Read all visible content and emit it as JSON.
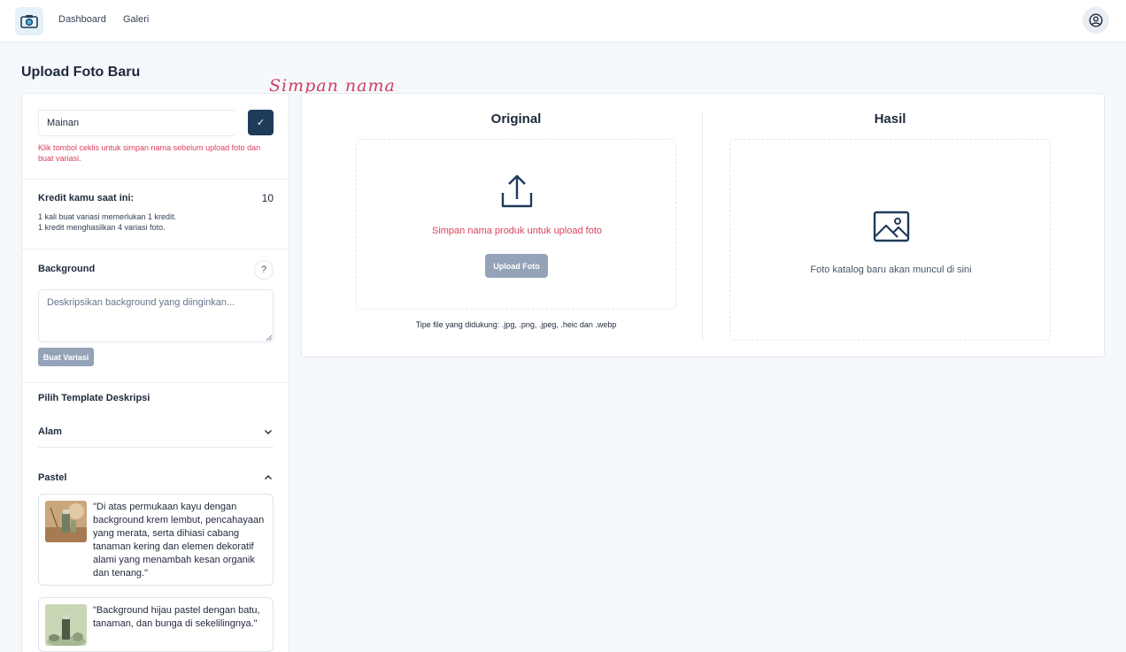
{
  "nav": {
    "items": [
      {
        "label": "Dashboard"
      },
      {
        "label": "Galeri"
      }
    ]
  },
  "page": {
    "title": "Upload Foto Baru",
    "annotation": "Simpan nama"
  },
  "name_section": {
    "value": "Mainan",
    "check_icon": "✓",
    "hint": "Klik tombol ceklis untuk simpan nama sebelum upload foto dan buat variasi."
  },
  "credit": {
    "label": "Kredit kamu saat ini:",
    "value": "10",
    "note_line1": "1 kali buat variasi memerlukan 1 kredit.",
    "note_line2": "1 kredit menghasilkan 4 variasi foto."
  },
  "background": {
    "label": "Background",
    "help": "?",
    "placeholder": "Deskripsikan background yang diinginkan...",
    "button": "Buat Variasi"
  },
  "templates": {
    "label": "Pilih Template Deskripsi",
    "groups": [
      {
        "name": "Alam",
        "expanded": false
      },
      {
        "name": "Pastel",
        "expanded": true
      }
    ],
    "items": [
      {
        "text": "\"Di atas permukaan kayu dengan background krem lembut, pencahayaan yang merata, serta dihiasi cabang tanaman kering dan elemen dekoratif alami yang menambah kesan organik dan tenang.\""
      },
      {
        "text": "\"Background hijau pastel dengan batu, tanaman, dan bunga di sekelilingnya.\""
      }
    ]
  },
  "original": {
    "title": "Original",
    "message": "Simpan nama produk untuk upload foto",
    "button": "Upload Foto",
    "filetypes": "Tipe file yang didukung: .jpg, .png, .jpeg, .heic dan .webp"
  },
  "result": {
    "title": "Hasil",
    "message": "Foto katalog baru akan muncul di sini"
  },
  "colors": {
    "accent": "#1f3b5a",
    "error": "#d9415f",
    "disabled": "#94a3b8"
  },
  "icons": {
    "logo": "camera-icon",
    "avatar": "user-circle-icon",
    "upload": "upload-icon",
    "image": "image-icon"
  }
}
